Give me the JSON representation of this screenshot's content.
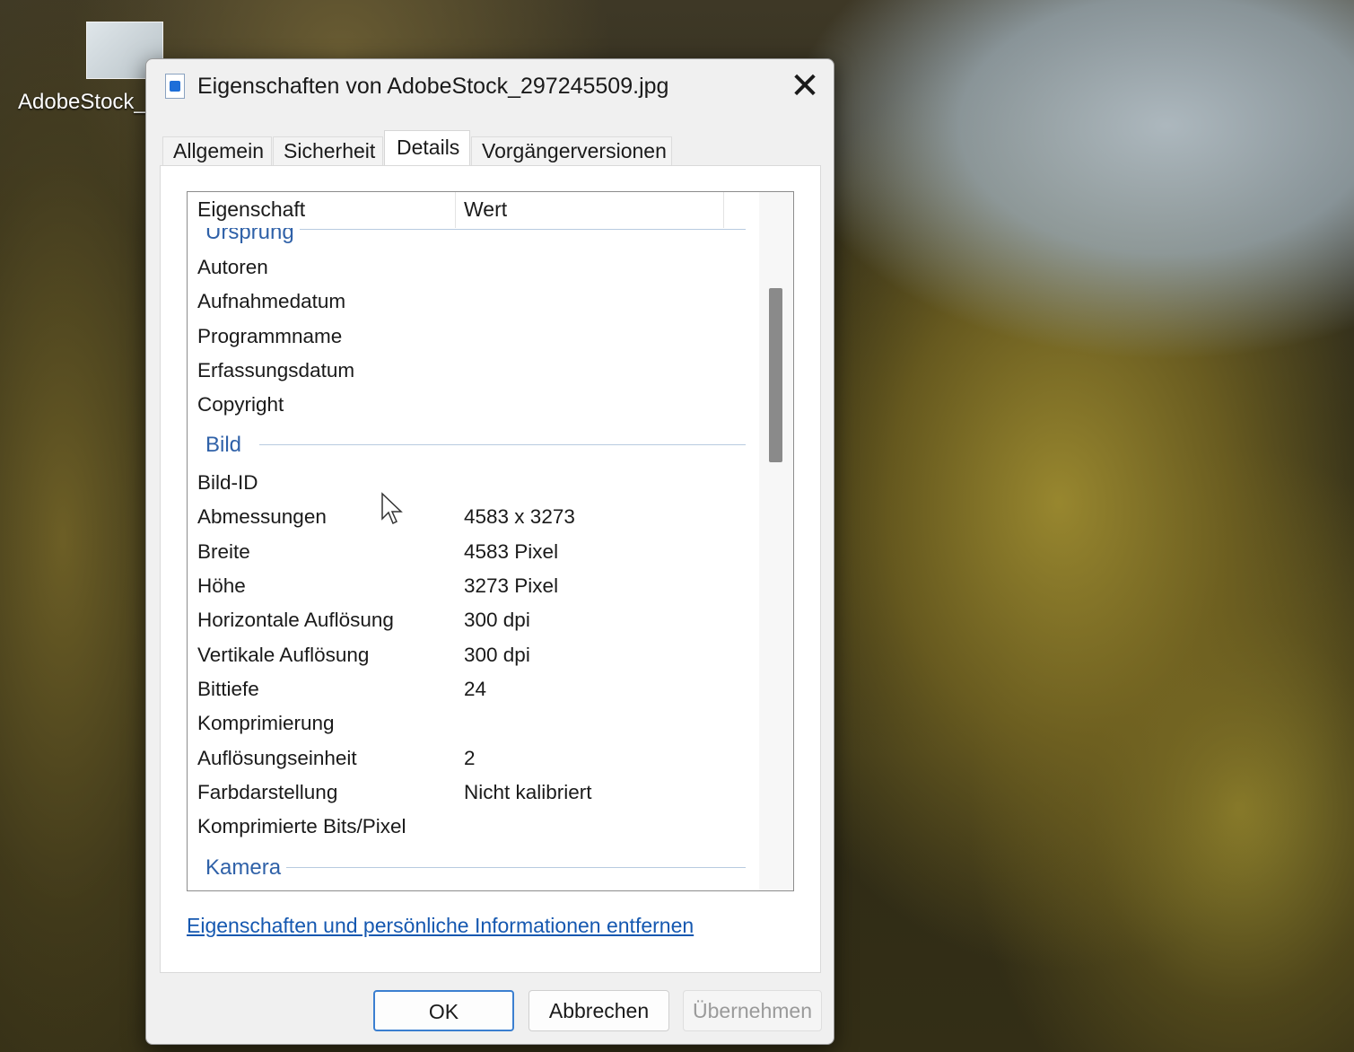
{
  "desktop": {
    "icon_label": "AdobeStock_"
  },
  "dialog": {
    "title": "Eigenschaften von AdobeStock_297245509.jpg",
    "close_symbol": "✕",
    "tabs": [
      {
        "label": "Allgemein",
        "active": false
      },
      {
        "label": "Sicherheit",
        "active": false
      },
      {
        "label": "Details",
        "active": true
      },
      {
        "label": "Vorgängerversionen",
        "active": false
      }
    ],
    "columns": {
      "property": "Eigenschaft",
      "value": "Wert"
    },
    "groups": {
      "ursprung": "Ursprung",
      "bild": "Bild",
      "kamera": "Kamera"
    },
    "rows": [
      {
        "prop": "Autoren",
        "value": ""
      },
      {
        "prop": "Aufnahmedatum",
        "value": ""
      },
      {
        "prop": "Programmname",
        "value": ""
      },
      {
        "prop": "Erfassungsdatum",
        "value": ""
      },
      {
        "prop": "Copyright",
        "value": ""
      },
      {
        "prop": "Bild-ID",
        "value": ""
      },
      {
        "prop": "Abmessungen",
        "value": "4583 x 3273"
      },
      {
        "prop": "Breite",
        "value": "4583 Pixel"
      },
      {
        "prop": "Höhe",
        "value": "3273 Pixel"
      },
      {
        "prop": "Horizontale Auflösung",
        "value": "300 dpi"
      },
      {
        "prop": "Vertikale Auflösung",
        "value": "300 dpi"
      },
      {
        "prop": "Bittiefe",
        "value": "24"
      },
      {
        "prop": "Komprimierung",
        "value": ""
      },
      {
        "prop": "Auflösungseinheit",
        "value": "2"
      },
      {
        "prop": "Farbdarstellung",
        "value": "Nicht kalibriert"
      },
      {
        "prop": "Komprimierte Bits/Pixel",
        "value": ""
      }
    ],
    "remove_link": "Eigenschaften und persönliche Informationen entfernen",
    "buttons": {
      "ok": "OK",
      "cancel": "Abbrechen",
      "apply": "Übernehmen"
    },
    "icons": {
      "title": "jpg-file-icon",
      "close": "close-icon",
      "cursor": "mouse-pointer-icon"
    }
  }
}
